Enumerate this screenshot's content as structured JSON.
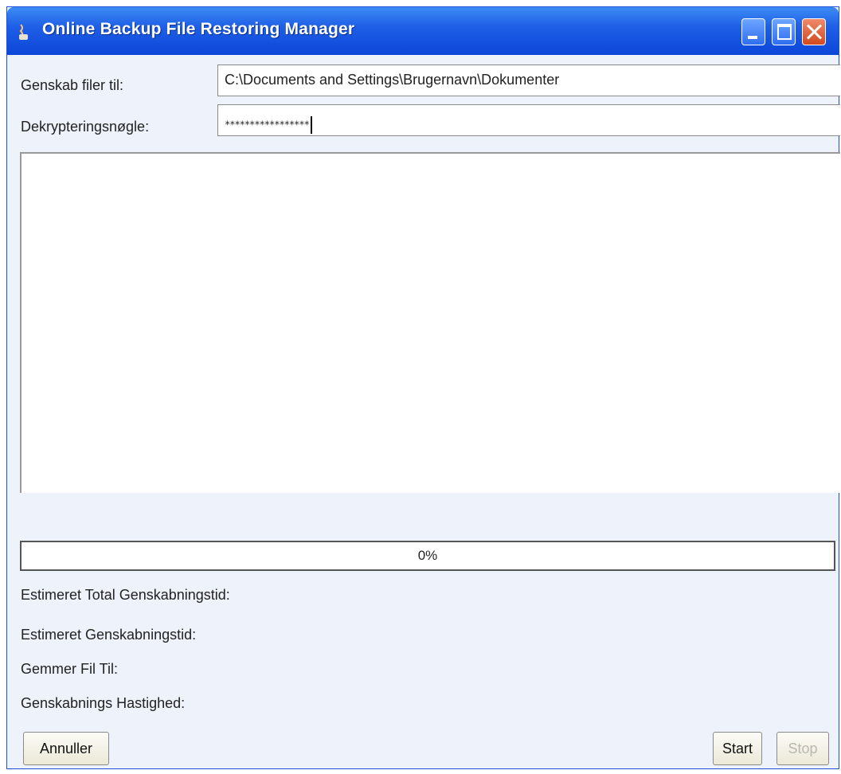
{
  "window": {
    "title": "Online Backup File Restoring Manager"
  },
  "form": {
    "restore_to_label": "Genskab filer til:",
    "restore_to_value": "C:\\Documents and Settings\\Brugernavn\\Dokumenter",
    "key_label": "Dekrypteringsnøgle:",
    "key_value": "*****************"
  },
  "progress": {
    "value_text": "0%",
    "fraction": 0.0
  },
  "status": {
    "total_time_label": "Estimeret Total Genskabningstid:",
    "time_label": "Estimeret Genskabningstid:",
    "saving_label": "Gemmer Fil Til:",
    "speed_label": "Genskabnings Hastighed:"
  },
  "buttons": {
    "cancel": "Annuller",
    "start": "Start",
    "stop": "Stop"
  },
  "icons": {
    "app": "java-cup-icon",
    "minimize": "minimize-icon",
    "maximize": "maximize-icon",
    "close": "close-icon"
  },
  "colors": {
    "titlebar": "#1f5fe6",
    "window_bg": "#eef3fb",
    "close_button": "#d24a1f"
  }
}
